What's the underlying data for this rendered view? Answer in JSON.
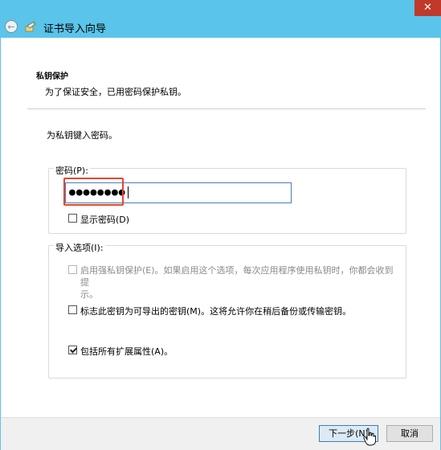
{
  "window": {
    "title": "证书导入向导",
    "close_glyph": "✕"
  },
  "header": {
    "section_title": "私钥保护",
    "section_description": "为了保证安全，已用密码保护私钥。"
  },
  "main": {
    "prompt": "为私钥键入密码。",
    "password_label": "密码(P):",
    "password_value": "●●●●●●●●",
    "show_password_label": "显示密码(D)",
    "show_password_checked": false,
    "import_options_label": "导入选项(I):",
    "options": [
      {
        "label_line1": "启用强私钥保护(E)。如果启用这个选项，每次应用程序使用私钥时，你都会收到提",
        "label_line2": "示。",
        "checked": false,
        "disabled": true
      },
      {
        "label_line1": "标志此密钥为可导出的密钥(M)。这将允许你在稍后备份或传输密钥。",
        "checked": false,
        "disabled": false
      },
      {
        "label_line1": "包括所有扩展属性(A)。",
        "checked": true,
        "disabled": false
      }
    ]
  },
  "footer": {
    "next_label": "下一步(N)",
    "cancel_label": "取消"
  },
  "colors": {
    "titlebar": "#5bc4ea",
    "highlight": "#e2492e",
    "close": "#c0392b"
  },
  "icons": {
    "back": "back-arrow-icon",
    "wizard": "certificate-wizard-icon",
    "close": "close-icon"
  }
}
